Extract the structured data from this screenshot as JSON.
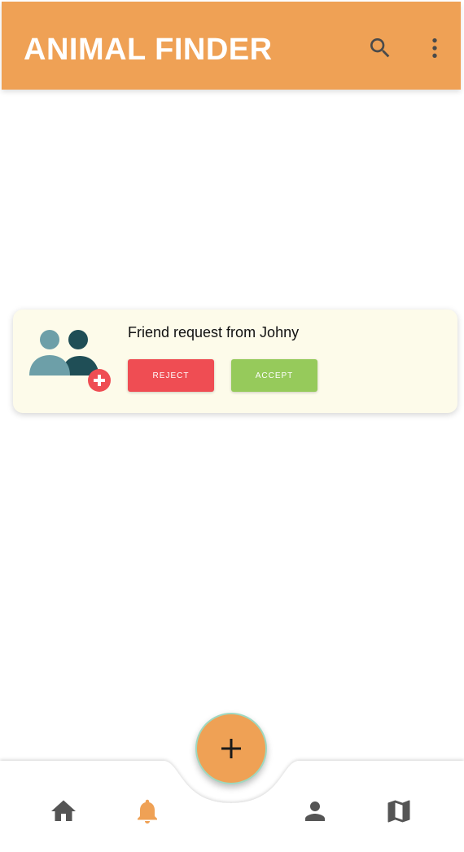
{
  "header": {
    "title": "ANIMAL FINDER",
    "search_icon": "search-icon",
    "more_icon": "more-vert-icon"
  },
  "notification": {
    "illustration_icon": "add-friend-icon",
    "text": "Friend request from Johny",
    "reject_label": "REJECT",
    "accept_label": "ACCEPT"
  },
  "bottom_nav": {
    "fab_icon": "plus-icon",
    "items": [
      {
        "icon": "home-icon",
        "active": false
      },
      {
        "icon": "bell-icon",
        "active": true
      },
      {
        "icon": "person-icon",
        "active": false
      },
      {
        "icon": "map-icon",
        "active": false
      }
    ]
  },
  "colors": {
    "primary": "#EFA155",
    "card_background": "#FDFBEA",
    "reject": "#EF4D53",
    "accept": "#96CA5B",
    "icon_inactive": "#555555",
    "icon_active": "#EFA155"
  }
}
